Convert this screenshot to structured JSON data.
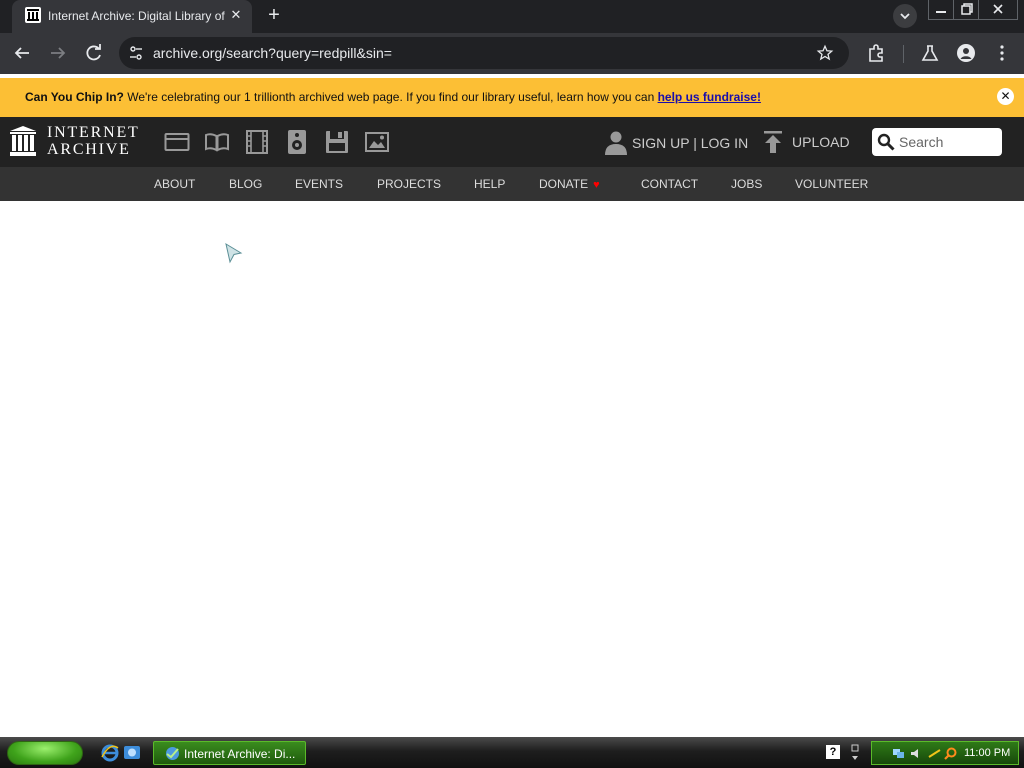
{
  "browser": {
    "tab_title": "Internet Archive: Digital Library of",
    "url": "archive.org/search?query=redpill&sin=",
    "window_controls": [
      "minimize-icon",
      "restore-icon",
      "close-icon"
    ]
  },
  "banner": {
    "lead": "Can You Chip In?",
    "text": " We're celebrating our 1 trillionth archived web page. If you find our library useful, learn how you can ",
    "link": "help us fundraise!",
    "close_glyph": "✕"
  },
  "ia_header": {
    "logo_line1": "INTERNET",
    "logo_line2": "ARCHIVE",
    "media_icons": [
      "web-icon",
      "texts-icon",
      "video-icon",
      "audio-icon",
      "software-icon",
      "images-icon"
    ],
    "signup_label": "SIGN UP | LOG IN",
    "upload_label": "UPLOAD",
    "search_placeholder": "Search"
  },
  "nav": {
    "items": [
      "ABOUT",
      "BLOG",
      "EVENTS",
      "PROJECTS",
      "HELP",
      "DONATE",
      "CONTACT",
      "JOBS",
      "VOLUNTEER"
    ]
  },
  "taskbar": {
    "task_label": "Internet Archive: Di...",
    "help_glyph": "?",
    "clock": "11:00 PM"
  },
  "colors": {
    "banner_bg": "#fcbf35",
    "header_bg": "#222222",
    "nav_bg": "#333333",
    "donate_heart": "#ff0000",
    "xp_green": "#3fa31b"
  }
}
